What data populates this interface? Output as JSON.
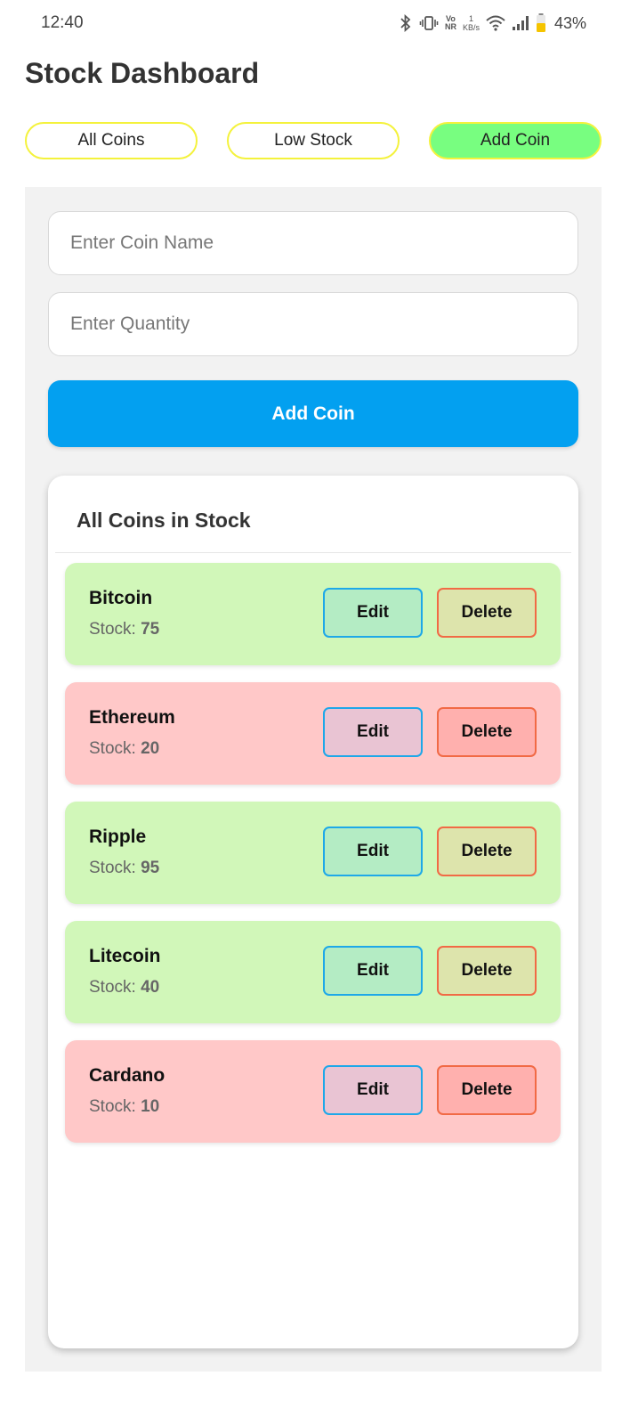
{
  "status_bar": {
    "time": "12:40",
    "icons": [
      "bluetooth-icon",
      "vibrate-icon",
      "vonr-icon",
      "network-speed-icon",
      "wifi-icon",
      "signal-icon",
      "battery-icon"
    ],
    "vonr_top": "Vo",
    "vonr_bottom": "NR",
    "net_speed_value": "1",
    "net_speed_unit": "KB/s",
    "battery": "43%"
  },
  "page": {
    "title": "Stock Dashboard"
  },
  "tabs": [
    {
      "label": "All Coins",
      "active": false
    },
    {
      "label": "Low Stock",
      "active": false
    },
    {
      "label": "Add Coin",
      "active": true
    }
  ],
  "form": {
    "coin_name_value": "",
    "coin_name_placeholder": "Enter Coin Name",
    "quantity_value": "",
    "quantity_placeholder": "Enter Quantity",
    "submit_label": "Add Coin"
  },
  "list": {
    "title": "All Coins in Stock",
    "stock_prefix": "Stock: ",
    "edit_label": "Edit",
    "delete_label": "Delete",
    "coins": [
      {
        "name": "Bitcoin",
        "stock": "75",
        "status": "ok"
      },
      {
        "name": "Ethereum",
        "stock": "20",
        "status": "low"
      },
      {
        "name": "Ripple",
        "stock": "95",
        "status": "ok"
      },
      {
        "name": "Litecoin",
        "stock": "40",
        "status": "ok"
      },
      {
        "name": "Cardano",
        "stock": "10",
        "status": "low"
      }
    ]
  },
  "colors": {
    "tab_border": "#f4f23c",
    "tab_active": "#78fe80",
    "primary_button": "#03a0f0",
    "ok_row": "#d1f7b9",
    "low_row": "#ffc8c8",
    "edit_border": "#1ea8e8",
    "delete_border": "#f16a45"
  }
}
